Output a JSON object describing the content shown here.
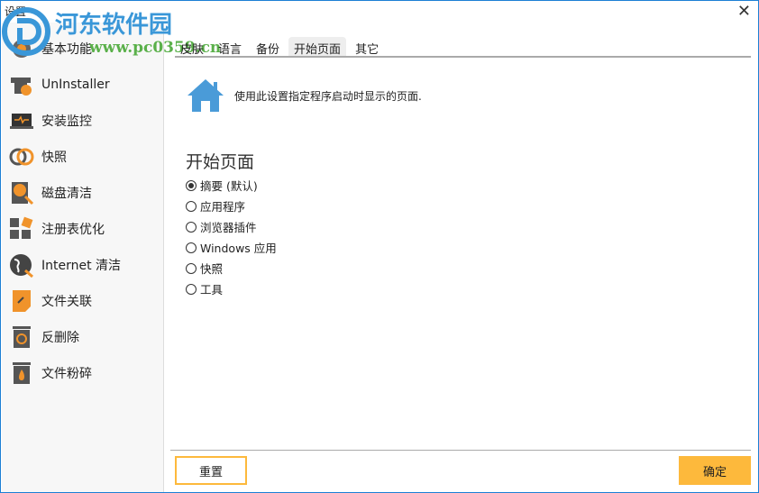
{
  "window": {
    "title": "设置",
    "close": "✕"
  },
  "watermark": {
    "name": "河东软件园",
    "url": "www.pc0359.cn"
  },
  "sidebar": {
    "items": [
      {
        "label": "基本功能",
        "icon": "gear-icon"
      },
      {
        "label": "UnInstaller",
        "icon": "uninstaller-icon"
      },
      {
        "label": "安装监控",
        "icon": "monitor-icon"
      },
      {
        "label": "快照",
        "icon": "snapshot-icon"
      },
      {
        "label": "磁盘清洁",
        "icon": "disk-clean-icon"
      },
      {
        "label": "注册表优化",
        "icon": "registry-icon"
      },
      {
        "label": "Internet 清洁",
        "icon": "globe-icon"
      },
      {
        "label": "文件关联",
        "icon": "file-link-icon"
      },
      {
        "label": "反删除",
        "icon": "undelete-icon"
      },
      {
        "label": "文件粉碎",
        "icon": "shredder-icon"
      }
    ]
  },
  "tabs": [
    {
      "label": "皮肤"
    },
    {
      "label": "语言"
    },
    {
      "label": "备份"
    },
    {
      "label": "开始页面",
      "active": true
    },
    {
      "label": "其它"
    }
  ],
  "main": {
    "info": "使用此设置指定程序启动时显示的页面.",
    "section": "开始页面",
    "options": [
      {
        "label": "摘要 (默认)",
        "checked": true
      },
      {
        "label": "应用程序"
      },
      {
        "label": "浏览器插件"
      },
      {
        "label": "Windows 应用"
      },
      {
        "label": "快照"
      },
      {
        "label": "工具"
      }
    ]
  },
  "footer": {
    "reset": "重置",
    "ok": "确定"
  },
  "colors": {
    "accent": "#fdb93c",
    "border": "#1c7fd4",
    "icon_blue": "#4a9bd8",
    "icon_orange": "#f0932b"
  }
}
